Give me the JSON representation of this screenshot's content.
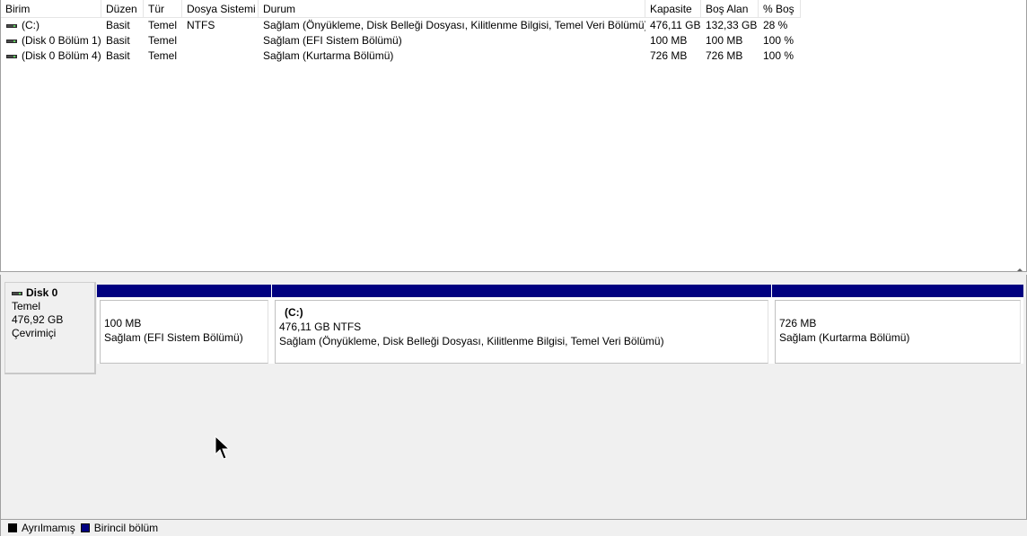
{
  "columns": {
    "birim": "Birim",
    "duzen": "Düzen",
    "tur": "Tür",
    "dosya_sistemi": "Dosya Sistemi",
    "durum": "Durum",
    "kapasite": "Kapasite",
    "bos_alan": "Boş Alan",
    "bos_yuzde": "% Boş"
  },
  "volumes": [
    {
      "birim": "(C:)",
      "duzen": "Basit",
      "tur": "Temel",
      "dosya_sistemi": "NTFS",
      "durum": "Sağlam (Önyükleme, Disk Belleği Dosyası, Kilitlenme Bilgisi, Temel Veri Bölümü)",
      "kapasite": "476,11 GB",
      "bos_alan": "132,33 GB",
      "bos_yuzde": "28 %"
    },
    {
      "birim": "(Disk 0 Bölüm 1)",
      "duzen": "Basit",
      "tur": "Temel",
      "dosya_sistemi": "",
      "durum": "Sağlam (EFI Sistem Bölümü)",
      "kapasite": "100 MB",
      "bos_alan": "100 MB",
      "bos_yuzde": "100 %"
    },
    {
      "birim": "(Disk 0 Bölüm 4)",
      "duzen": "Basit",
      "tur": "Temel",
      "dosya_sistemi": "",
      "durum": "Sağlam (Kurtarma Bölümü)",
      "kapasite": "726 MB",
      "bos_alan": "726 MB",
      "bos_yuzde": "100 %"
    }
  ],
  "disk": {
    "name": "Disk 0",
    "type": "Temel",
    "size": "476,92 GB",
    "status": "Çevrimiçi",
    "partitions": [
      {
        "name": "",
        "size": "100 MB",
        "status": "Sağlam (EFI Sistem Bölümü)"
      },
      {
        "name": "(C:)",
        "size": "476,11 GB NTFS",
        "status": "Sağlam (Önyükleme, Disk Belleği Dosyası, Kilitlenme Bilgisi, Temel Veri Bölümü)"
      },
      {
        "name": "",
        "size": "726 MB",
        "status": "Sağlam (Kurtarma Bölümü)"
      }
    ]
  },
  "legend": {
    "unallocated": "Ayrılmamış",
    "primary": "Birincil bölüm",
    "unallocated_color": "#000000",
    "primary_color": "#000080"
  },
  "icons": {
    "drive": "drive-icon",
    "cursor": "mouse-cursor-icon"
  }
}
